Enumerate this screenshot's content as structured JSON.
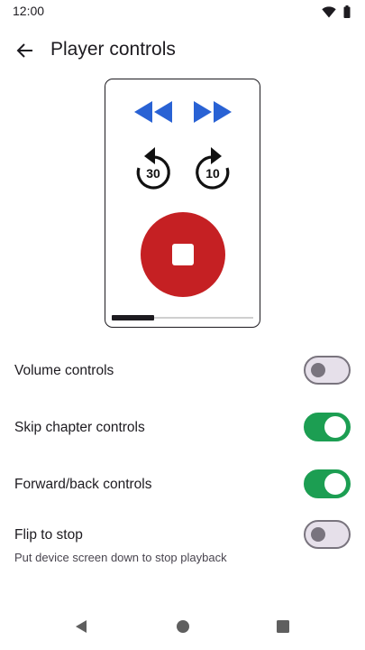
{
  "status_bar": {
    "time": "12:00",
    "icons": [
      "wifi-icon",
      "battery-icon"
    ]
  },
  "app_bar": {
    "back_icon": "arrow-back-icon",
    "title": "Player controls"
  },
  "preview": {
    "controls": [
      "skip-previous-chapter-icon",
      "skip-next-chapter-icon",
      "rewind-30-icon",
      "forward-10-icon",
      "stop-icon"
    ],
    "rewind_seconds": "30",
    "forward_seconds": "10",
    "progress": 0.3,
    "colors": {
      "skip": "#2962d4",
      "stop": "#c52023"
    }
  },
  "settings": [
    {
      "label": "Volume controls",
      "subtitle": "",
      "enabled": false
    },
    {
      "label": "Skip chapter controls",
      "subtitle": "",
      "enabled": true
    },
    {
      "label": "Forward/back controls",
      "subtitle": "",
      "enabled": true
    },
    {
      "label": "Flip to stop",
      "subtitle": "Put device screen down to stop playback",
      "enabled": false
    }
  ],
  "colors": {
    "switch_on": "#1c9e52",
    "switch_off": "#e6e0ea"
  },
  "nav_bar": {
    "icons": [
      "nav-back-icon",
      "nav-home-icon",
      "nav-recents-icon"
    ]
  }
}
